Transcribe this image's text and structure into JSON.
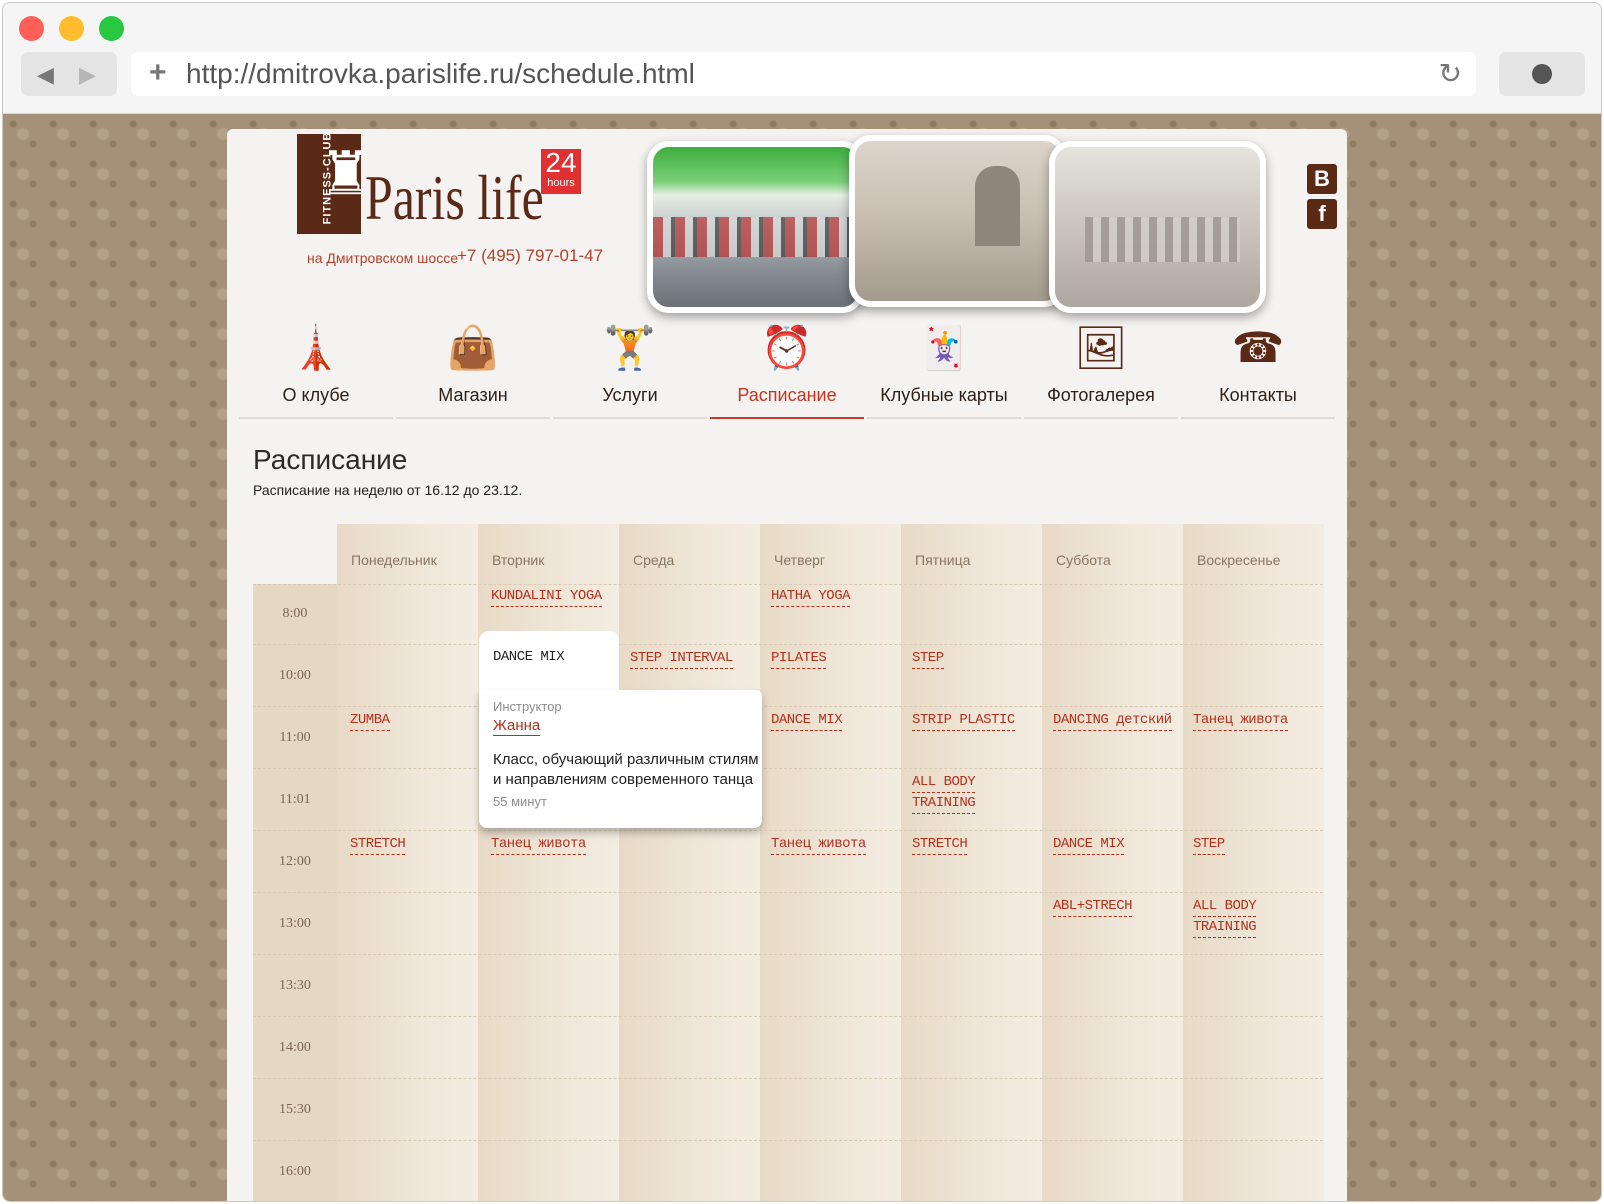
{
  "browser": {
    "url": "http://dmitrovka.parislife.ru/schedule.html"
  },
  "header": {
    "logo_vertical": "FITNESS-CLUB",
    "logo_name": "Paris life",
    "badge_number": "24",
    "badge_text": "hours",
    "location": "на Дмитровском шоссе",
    "phone": "+7 (495) 797-01-47",
    "social": {
      "vk": "B",
      "fb": "f"
    }
  },
  "menu": [
    {
      "label": "О клубе",
      "icon": "eiffel-tower-icon"
    },
    {
      "label": "Магазин",
      "icon": "shopping-bag-icon"
    },
    {
      "label": "Услуги",
      "icon": "dumbbell-icon"
    },
    {
      "label": "Расписание",
      "icon": "alarm-clock-icon",
      "active": true
    },
    {
      "label": "Клубные карты",
      "icon": "cards-icon"
    },
    {
      "label": "Фотогалерея",
      "icon": "photo-frame-icon"
    },
    {
      "label": "Контакты",
      "icon": "telephone-icon"
    }
  ],
  "page": {
    "title": "Расписание",
    "subtitle": "Расписание на неделю от 16.12 до 23.12."
  },
  "schedule": {
    "days": [
      "Понедельник",
      "Вторник",
      "Среда",
      "Четверг",
      "Пятница",
      "Суббота",
      "Воскресенье"
    ],
    "times": [
      "8:00",
      "10:00",
      "11:00",
      "11:01",
      "12:00",
      "13:00",
      "13:30",
      "14:00",
      "15:30",
      "16:00"
    ],
    "classes": {
      "tue_8": "KUNDALINI YOGA",
      "thu_8": "HATHA YOGA",
      "wed_10": "STEP INTERVAL",
      "thu_10": "PILATES",
      "fri_10": "STEP",
      "mon_11": "ZUMBA",
      "thu_11": "DANCE MIX",
      "fri_11": "STRIP PLASTIC",
      "sat_11": "DANCING детский",
      "sun_11": "Танец живота",
      "fri_1101_a": "ALL BODY",
      "fri_1101_b": "TRAINING",
      "mon_12": "STRETCH",
      "tue_12": "Танец живота",
      "thu_12": "Танец живота",
      "fri_12": "STRETCH",
      "sat_12": "DANCE MIX",
      "sun_12": "STEP",
      "sat_13": "ABL+STRECH",
      "sun_13_a": "ALL BODY",
      "sun_13_b": "TRAINING"
    },
    "popup": {
      "name": "DANCE MIX",
      "instructor_label": "Инструктор",
      "instructor": "Жанна",
      "description": "Класс, обучающий различным стилям и направлениям современного танца",
      "duration": "55 минут"
    }
  }
}
